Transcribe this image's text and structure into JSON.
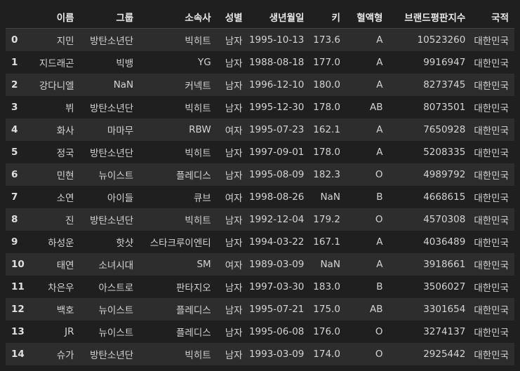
{
  "table": {
    "columns": [
      "",
      "이름",
      "그룹",
      "소속사",
      "성별",
      "생년월일",
      "키",
      "혈액형",
      "브랜드평판지수",
      "국적"
    ],
    "rows": [
      [
        "0",
        "지민",
        "방탄소년단",
        "빅히트",
        "남자",
        "1995-10-13",
        "173.6",
        "A",
        "10523260",
        "대한민국"
      ],
      [
        "1",
        "지드래곤",
        "빅뱅",
        "YG",
        "남자",
        "1988-08-18",
        "177.0",
        "A",
        "9916947",
        "대한민국"
      ],
      [
        "2",
        "강다니엘",
        "NaN",
        "커넥트",
        "남자",
        "1996-12-10",
        "180.0",
        "A",
        "8273745",
        "대한민국"
      ],
      [
        "3",
        "뷔",
        "방탄소년단",
        "빅히트",
        "남자",
        "1995-12-30",
        "178.0",
        "AB",
        "8073501",
        "대한민국"
      ],
      [
        "4",
        "화사",
        "마마무",
        "RBW",
        "여자",
        "1995-07-23",
        "162.1",
        "A",
        "7650928",
        "대한민국"
      ],
      [
        "5",
        "정국",
        "방탄소년단",
        "빅히트",
        "남자",
        "1997-09-01",
        "178.0",
        "A",
        "5208335",
        "대한민국"
      ],
      [
        "6",
        "민현",
        "뉴이스트",
        "플레디스",
        "남자",
        "1995-08-09",
        "182.3",
        "O",
        "4989792",
        "대한민국"
      ],
      [
        "7",
        "소연",
        "아이들",
        "큐브",
        "여자",
        "1998-08-26",
        "NaN",
        "B",
        "4668615",
        "대한민국"
      ],
      [
        "8",
        "진",
        "방탄소년단",
        "빅히트",
        "남자",
        "1992-12-04",
        "179.2",
        "O",
        "4570308",
        "대한민국"
      ],
      [
        "9",
        "하성운",
        "핫샷",
        "스타크루이엔티",
        "남자",
        "1994-03-22",
        "167.1",
        "A",
        "4036489",
        "대한민국"
      ],
      [
        "10",
        "태연",
        "소녀시대",
        "SM",
        "여자",
        "1989-03-09",
        "NaN",
        "A",
        "3918661",
        "대한민국"
      ],
      [
        "11",
        "차은우",
        "아스트로",
        "판타지오",
        "남자",
        "1997-03-30",
        "183.0",
        "B",
        "3506027",
        "대한민국"
      ],
      [
        "12",
        "백호",
        "뉴이스트",
        "플레디스",
        "남자",
        "1995-07-21",
        "175.0",
        "AB",
        "3301654",
        "대한민국"
      ],
      [
        "13",
        "JR",
        "뉴이스트",
        "플레디스",
        "남자",
        "1995-06-08",
        "176.0",
        "O",
        "3274137",
        "대한민국"
      ],
      [
        "14",
        "슈가",
        "방탄소년단",
        "빅히트",
        "남자",
        "1993-03-09",
        "174.0",
        "O",
        "2925442",
        "대한민국"
      ]
    ]
  },
  "colors": {
    "background": "#1f1f1f",
    "row_stripe": "#2d2d2d",
    "text": "#d4d4d4"
  }
}
